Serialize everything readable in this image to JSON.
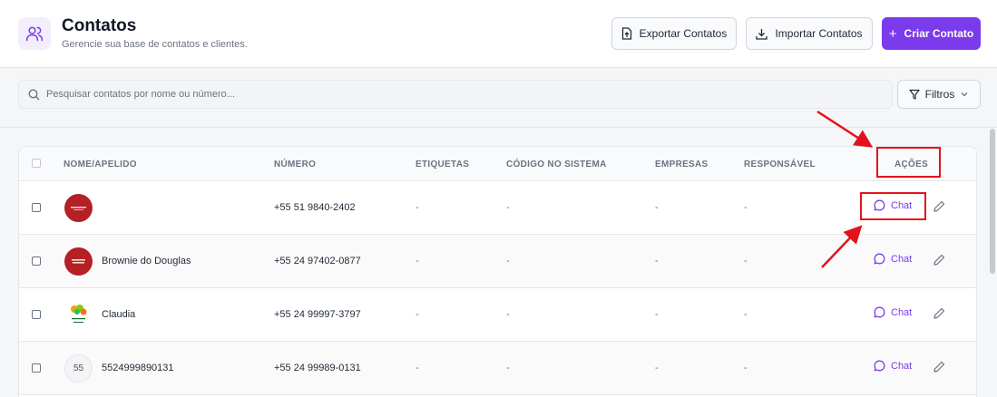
{
  "header": {
    "title": "Contatos",
    "subtitle": "Gerencie sua base de contatos e clientes.",
    "export_label": "Exportar Contatos",
    "import_label": "Importar Contatos",
    "create_label": "Criar Contato"
  },
  "search": {
    "placeholder": "Pesquisar contatos por nome ou número...",
    "value": ""
  },
  "filter": {
    "label": "Filtros"
  },
  "table": {
    "columns": [
      "NOME/APELIDO",
      "NÚMERO",
      "ETIQUETAS",
      "CÓDIGO NO SISTEMA",
      "EMPRESAS",
      "RESPONSÁVEL",
      "AÇÕES"
    ],
    "rows": [
      {
        "name": "",
        "avatar": "logo-red",
        "number": "+55 51 9840-2402",
        "tags": "-",
        "system_code": "-",
        "companies": "-",
        "responsible": "-",
        "chat_label": "Chat"
      },
      {
        "name": "Brownie do Douglas",
        "avatar": "brownie-logo",
        "number": "+55 24 97402-0877",
        "tags": "-",
        "system_code": "-",
        "companies": "-",
        "responsible": "-",
        "chat_label": "Chat"
      },
      {
        "name": "Claudia",
        "avatar": "flower-logo",
        "number": "+55 24 99997-3797",
        "tags": "-",
        "system_code": "-",
        "companies": "-",
        "responsible": "-",
        "chat_label": "Chat"
      },
      {
        "name": "5524999890131",
        "avatar": "initials",
        "initials": "55",
        "number": "+55 24 99989-0131",
        "tags": "-",
        "system_code": "-",
        "companies": "-",
        "responsible": "-",
        "chat_label": "Chat"
      }
    ]
  },
  "colors": {
    "accent": "#7c3aed",
    "annotation": "#e3131b"
  },
  "icons": {
    "header": "users-icon",
    "export": "file-export-icon",
    "import": "download-icon",
    "create": "plus-icon",
    "search": "search-icon",
    "filter": "filter-icon",
    "chevron": "chevron-down-icon",
    "chat": "message-circle-icon",
    "edit": "pencil-icon"
  }
}
